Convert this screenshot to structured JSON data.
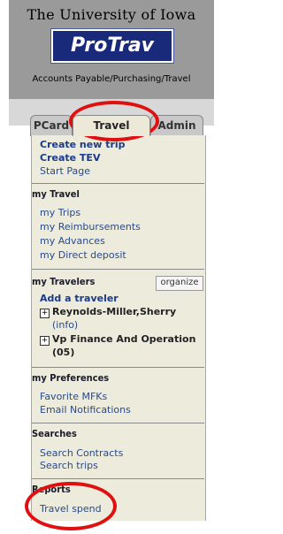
{
  "header": {
    "university": "The University of Iowa",
    "logo": "ProTrav",
    "subtitle": "Accounts Payable/Purchasing/Travel"
  },
  "tabs": [
    {
      "label": "PCard"
    },
    {
      "label": "Travel"
    },
    {
      "label": "Admin"
    }
  ],
  "top_links": [
    "Create new trip",
    "Create TEV",
    "Start Page"
  ],
  "my_travel": {
    "title": "my Travel",
    "items": [
      "my Trips",
      "my Reimbursements",
      "my Advances",
      "my Direct deposit"
    ]
  },
  "my_travelers": {
    "title": "my Travelers",
    "organize_label": "organize",
    "add_label": "Add a traveler",
    "travelers": [
      {
        "name": "Reynolds-Miller,Sherry",
        "sub": "(info)"
      },
      {
        "name": "Vp Finance And Operation",
        "sub": "(05)"
      }
    ]
  },
  "my_preferences": {
    "title": "my Preferences",
    "items": [
      "Favorite MFKs",
      "Email Notifications"
    ]
  },
  "searches": {
    "title": "Searches",
    "items": [
      "Search Contracts",
      "Search trips"
    ]
  },
  "reports": {
    "title": "Reports",
    "items": [
      "Travel spend"
    ]
  },
  "annotation_color": "#e01010"
}
